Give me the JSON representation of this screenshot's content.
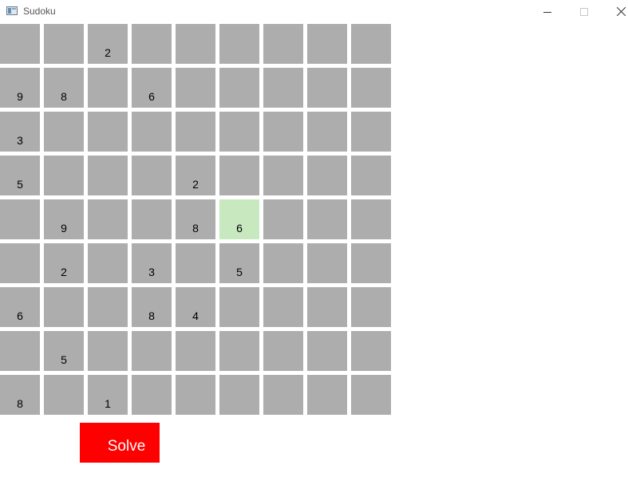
{
  "window": {
    "title": "Sudoku",
    "app_icon": "window-app-icon",
    "controls": {
      "minimize_icon": "minimize-icon",
      "maximize_icon": "maximize-icon",
      "close_icon": "close-icon"
    }
  },
  "board": {
    "rows": [
      [
        "",
        "",
        "2",
        "",
        "",
        "",
        "",
        "",
        ""
      ],
      [
        "9",
        "8",
        "",
        "6",
        "",
        "",
        "",
        "",
        ""
      ],
      [
        "3",
        "",
        "",
        "",
        "",
        "",
        "",
        "",
        ""
      ],
      [
        "5",
        "",
        "",
        "",
        "2",
        "",
        "",
        "",
        ""
      ],
      [
        "",
        "9",
        "",
        "",
        "8",
        "6",
        "",
        "",
        ""
      ],
      [
        "",
        "2",
        "",
        "3",
        "",
        "5",
        "",
        "",
        ""
      ],
      [
        "6",
        "",
        "",
        "8",
        "4",
        "",
        "",
        "",
        ""
      ],
      [
        "",
        "5",
        "",
        "",
        "",
        "",
        "",
        "",
        ""
      ],
      [
        "8",
        "",
        "1",
        "",
        "",
        "",
        "",
        "",
        ""
      ]
    ],
    "highlighted_cell": {
      "row": 4,
      "col": 5
    },
    "colors": {
      "cell": "#adadad",
      "highlight": "#c8e8c0"
    }
  },
  "solve_button": {
    "label": "Solve",
    "color": "#ff0000"
  }
}
